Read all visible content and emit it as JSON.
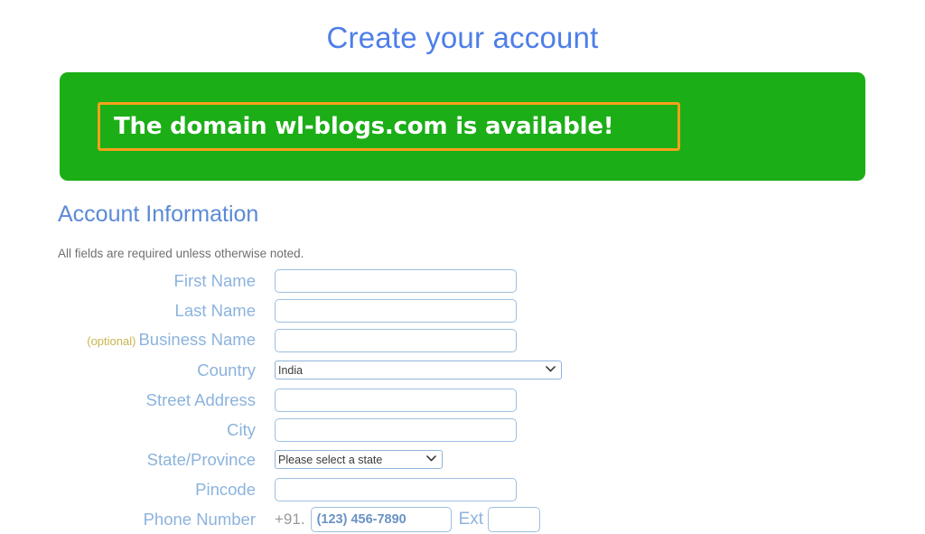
{
  "page": {
    "title": "Create your account"
  },
  "alert": {
    "message": "The domain wl-blogs.com is available!",
    "background_color": "#1cae17",
    "border_color": "#f6a01b",
    "text_color": "#ffffff"
  },
  "section": {
    "heading": "Account Information",
    "note": "All fields are required unless otherwise noted.",
    "heading_color": "#5b8ad6"
  },
  "form": {
    "optional_tag": "(optional)",
    "phone_prefix": "+91.",
    "ext_label": "Ext",
    "label_color": "#8cb3dd",
    "optional_color": "#c8b551",
    "fields": {
      "first_name": {
        "label": "First Name",
        "value": "",
        "placeholder": ""
      },
      "last_name": {
        "label": "Last Name",
        "value": "",
        "placeholder": ""
      },
      "business_name": {
        "label": "Business Name",
        "value": "",
        "placeholder": ""
      },
      "country": {
        "label": "Country",
        "value": "India"
      },
      "street_address": {
        "label": "Street Address",
        "value": "",
        "placeholder": ""
      },
      "city": {
        "label": "City",
        "value": "",
        "placeholder": ""
      },
      "state": {
        "label": "State/Province",
        "value": "Please select a state"
      },
      "pincode": {
        "label": "Pincode",
        "value": "",
        "placeholder": ""
      },
      "phone": {
        "label": "Phone Number",
        "value": "",
        "placeholder": "(123) 456-7890"
      },
      "ext": {
        "value": "",
        "placeholder": ""
      }
    }
  },
  "icons": {
    "chevron_down": "⌄"
  }
}
